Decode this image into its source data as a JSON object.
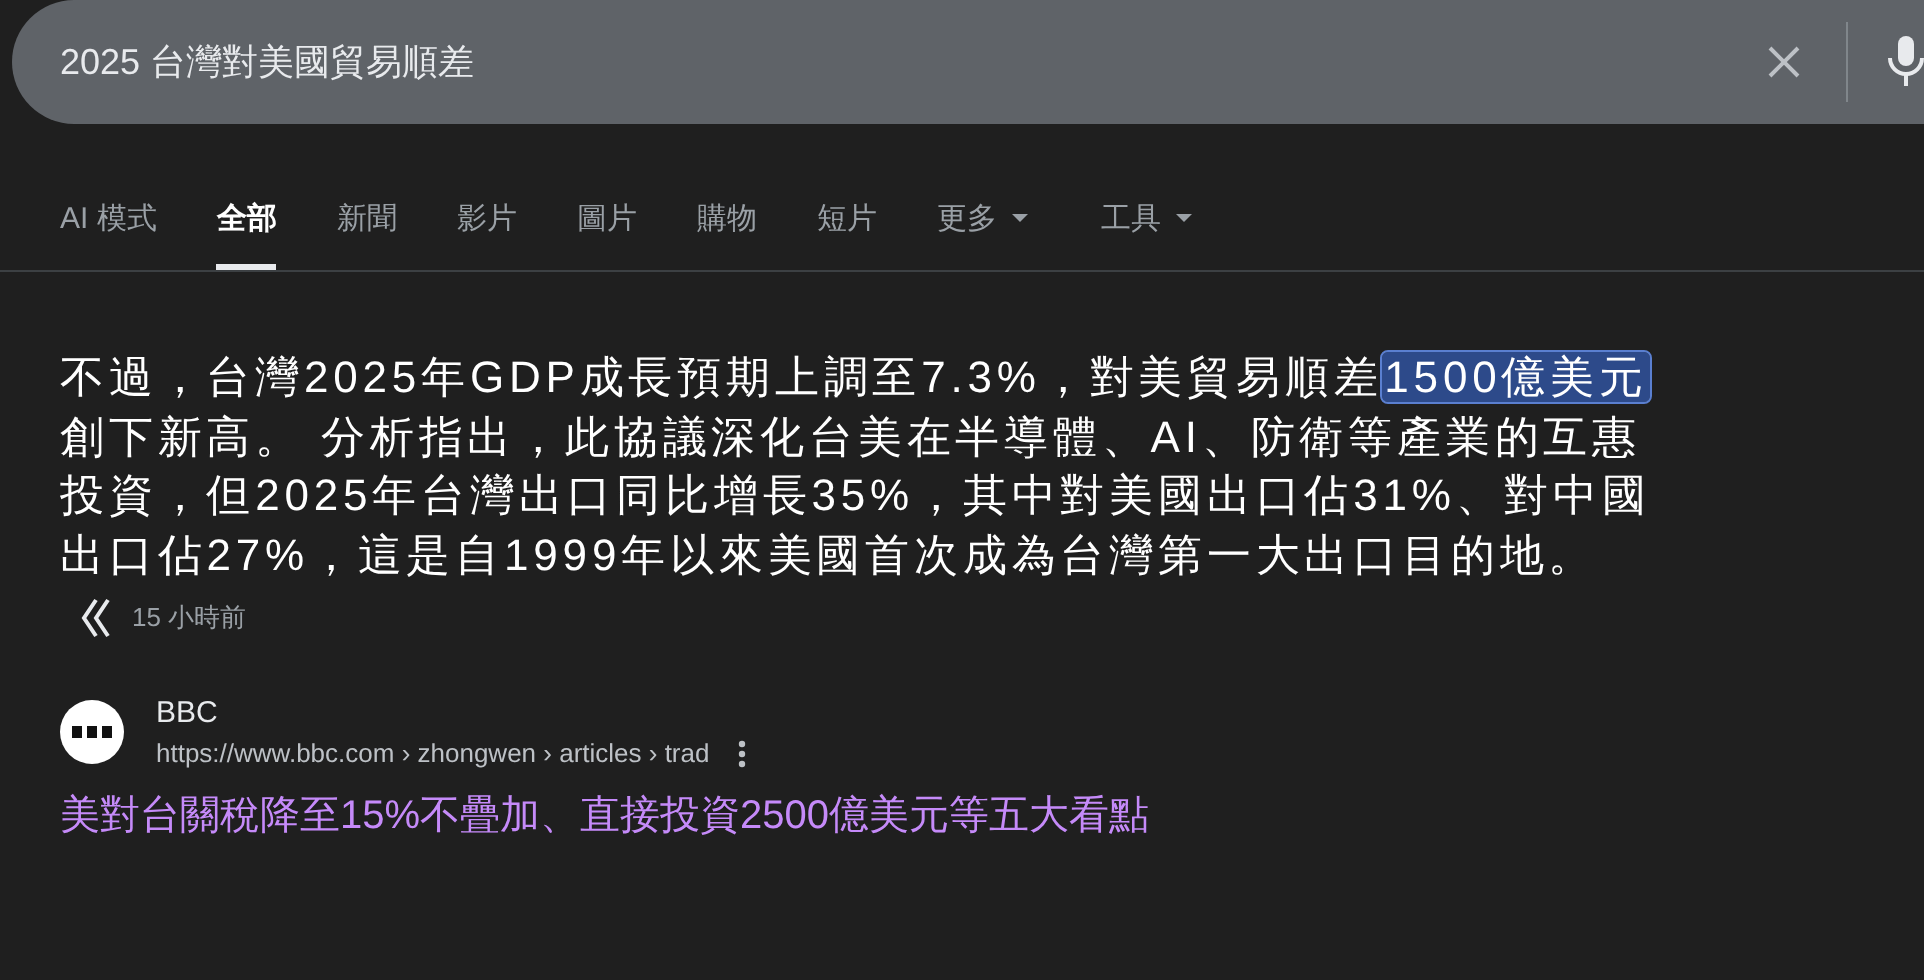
{
  "search": {
    "value": "2025 台灣對美國貿易順差"
  },
  "tabs": [
    {
      "label": "AI 模式",
      "selected": false,
      "dropdown": false
    },
    {
      "label": "全部",
      "selected": true,
      "dropdown": false
    },
    {
      "label": "新聞",
      "selected": false,
      "dropdown": false
    },
    {
      "label": "影片",
      "selected": false,
      "dropdown": false
    },
    {
      "label": "圖片",
      "selected": false,
      "dropdown": false
    },
    {
      "label": "購物",
      "selected": false,
      "dropdown": false
    },
    {
      "label": "短片",
      "selected": false,
      "dropdown": false
    },
    {
      "label": "更多",
      "selected": false,
      "dropdown": true
    },
    {
      "label": "工具",
      "selected": false,
      "dropdown": true
    }
  ],
  "snippet": {
    "parts": [
      {
        "text": "不過，台灣2025年GDP成長預期上調至7.3%，對美貿易順差",
        "highlighted": false
      },
      {
        "text": "1500億美元",
        "highlighted": true
      },
      {
        "text": "創下新高。 分析指出，此協議深化台美在半導體、AI、防衛等產業的互惠投資，但2025年台灣出口同比增長35%，其中對美國出口佔31%、對中國出口佔27%，這是自1999年以來美國首次成為台灣第一大出口目的地。",
        "highlighted": false
      }
    ],
    "time": "15 小時前"
  },
  "result": {
    "source": "BBC",
    "url": "https://www.bbc.com › zhongwen › articles › trad",
    "title": "美對台關稅降至15%不疊加、直接投資2500億美元等五大看點"
  }
}
